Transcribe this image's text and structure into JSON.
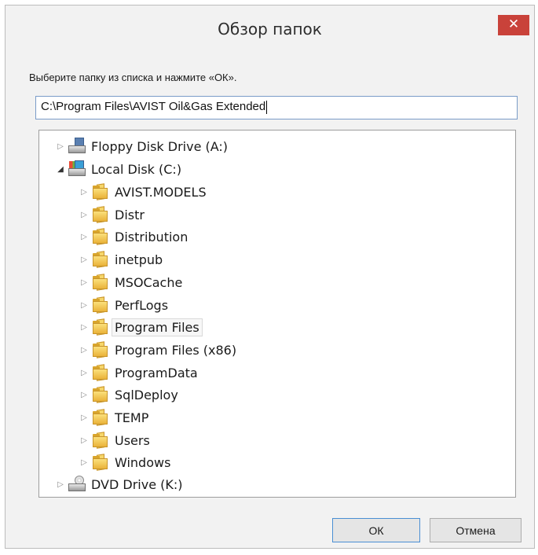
{
  "dialog": {
    "title": "Обзор папок",
    "close_label": "✕",
    "instruction": "Выберите папку из списка и нажмите «ОК».",
    "path_value": "C:\\Program Files\\AVIST Oil&Gas Extended"
  },
  "tree": {
    "drives": {
      "floppy": {
        "label": "Floppy Disk Drive (A:)",
        "icon": "floppy-drive-icon",
        "expander": "▷"
      },
      "local": {
        "label": "Local Disk (C:)",
        "icon": "local-disk-icon",
        "expander": "◢"
      },
      "dvd": {
        "label": "DVD Drive (K:)",
        "icon": "dvd-drive-icon",
        "expander": "▷"
      }
    },
    "folders": [
      {
        "label": "AVIST.MODELS"
      },
      {
        "label": "Distr"
      },
      {
        "label": "Distribution"
      },
      {
        "label": "inetpub"
      },
      {
        "label": "MSOCache"
      },
      {
        "label": "PerfLogs"
      },
      {
        "label": "Program Files",
        "selected": true
      },
      {
        "label": "Program Files (x86)"
      },
      {
        "label": "ProgramData"
      },
      {
        "label": "SqlDeploy"
      },
      {
        "label": "TEMP"
      },
      {
        "label": "Users"
      },
      {
        "label": "Windows"
      }
    ],
    "folder_expander": "▷"
  },
  "buttons": {
    "ok": "ОК",
    "cancel": "Отмена"
  },
  "colors": {
    "close_button": "#c9423a",
    "input_border": "#7a9cc8",
    "ok_border": "#4a8fd4"
  }
}
